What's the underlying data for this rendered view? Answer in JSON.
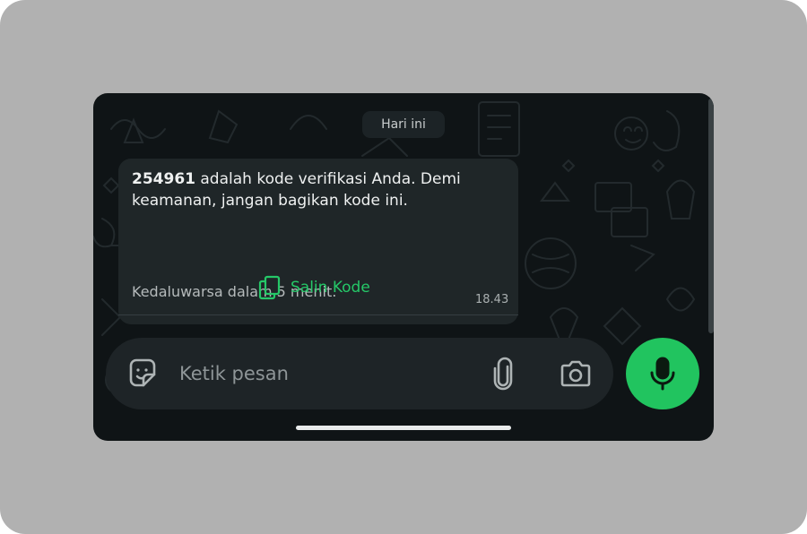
{
  "chat": {
    "date_label": "Hari ini",
    "message": {
      "code": "254961",
      "text": " adalah kode verifikasi Anda. Demi keamanan, jangan bagikan kode ini.",
      "expiry": "Kedaluwarsa dalam 5 menit.",
      "time": "18.43",
      "copy_label": "Salin Kode"
    }
  },
  "composer": {
    "placeholder": "Ketik pesan"
  },
  "icons": {
    "copy": "copy-icon",
    "sticker": "sticker-icon",
    "attach": "paperclip-icon",
    "camera": "camera-icon",
    "mic": "microphone-icon"
  },
  "colors": {
    "accent": "#21c45f",
    "background": "#0f1416",
    "bubble": "#1f2628",
    "frame": "#b1b1b1"
  }
}
